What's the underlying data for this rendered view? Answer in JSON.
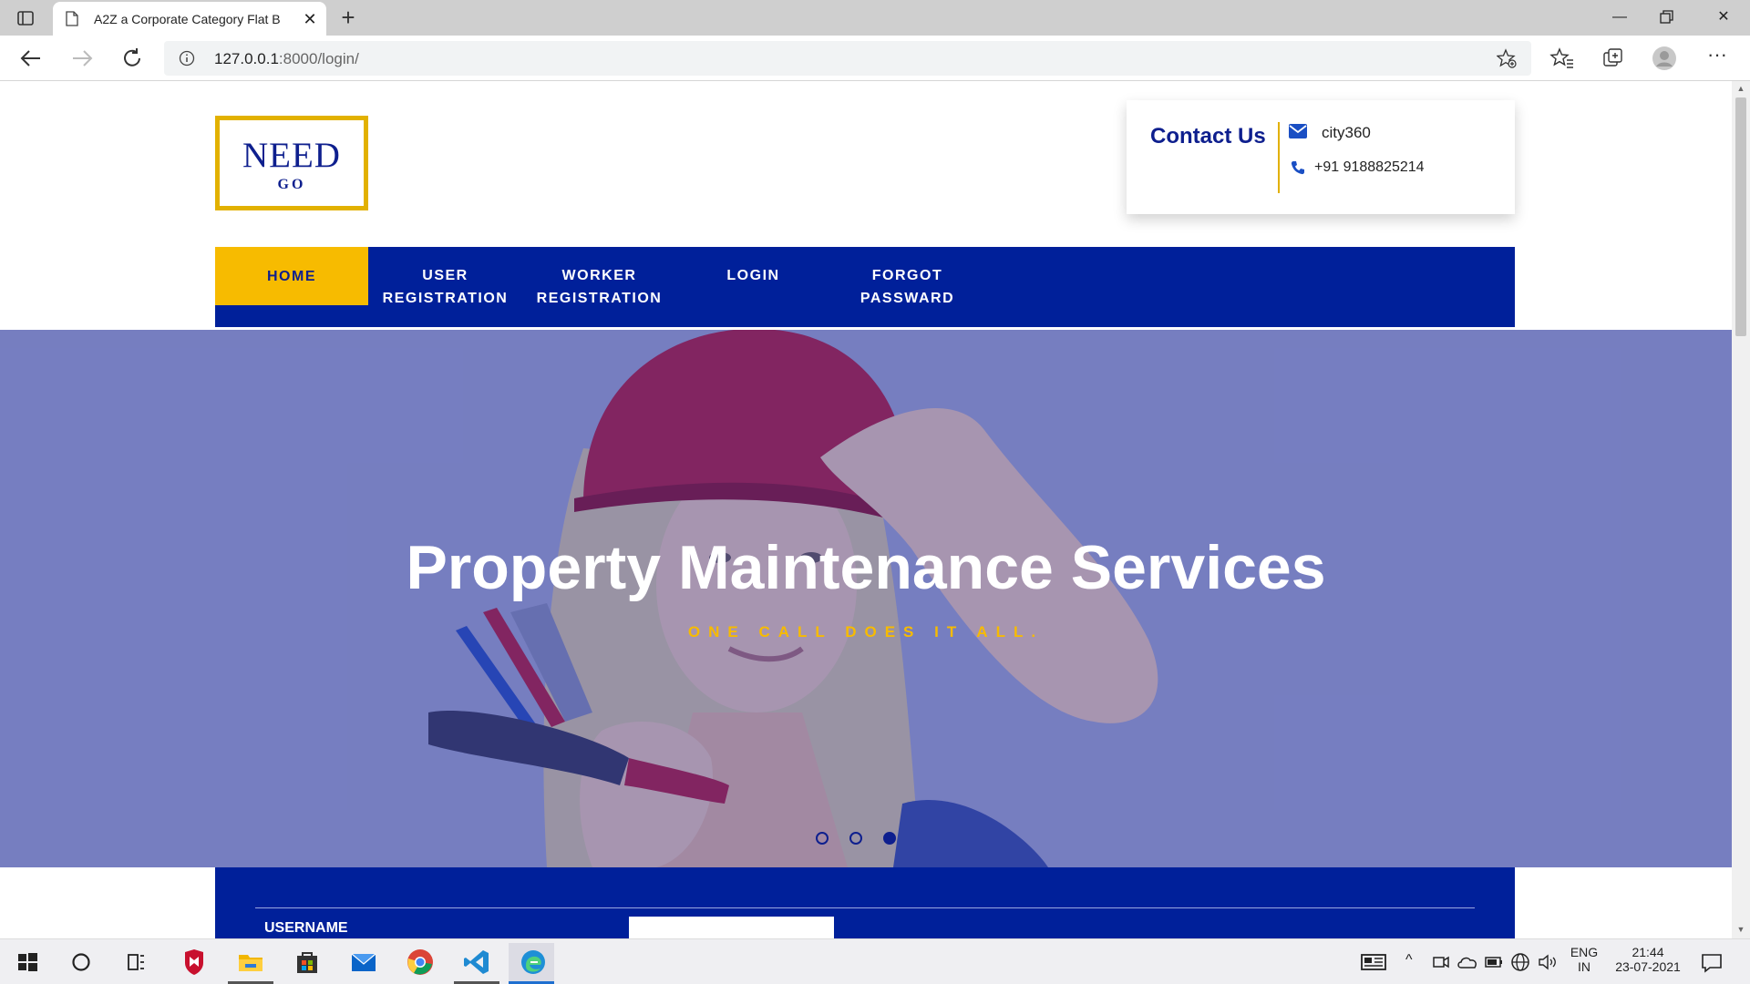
{
  "browser": {
    "tab_title": "A2Z a Corporate Category Flat B",
    "url_host": "127.0.0.1",
    "url_path": ":8000/login/"
  },
  "site": {
    "logo_main": "NEED",
    "logo_sub": "GO",
    "contact_title": "Contact Us",
    "contact_email": "city360",
    "contact_phone": "+91 9188825214",
    "nav": [
      {
        "line1": "HOME",
        "line2": ""
      },
      {
        "line1": "USER",
        "line2": "REGISTRATION"
      },
      {
        "line1": "WORKER",
        "line2": "REGISTRATION"
      },
      {
        "line1": "LOGIN",
        "line2": ""
      },
      {
        "line1": "FORGOT",
        "line2": "PASSWARD"
      }
    ],
    "hero_title": "Property Maintenance Services",
    "hero_subtitle": "ONE CALL DOES IT ALL.",
    "slider_active_index": 3,
    "username_label": "USERNAME",
    "username_value": ""
  },
  "taskbar": {
    "lang_top": "ENG",
    "lang_bottom": "IN",
    "time": "21:44",
    "date": "23-07-2021"
  },
  "colors": {
    "brand_blue": "#00209a",
    "accent_yellow": "#f7bb00",
    "logo_gold": "#e2b100"
  }
}
